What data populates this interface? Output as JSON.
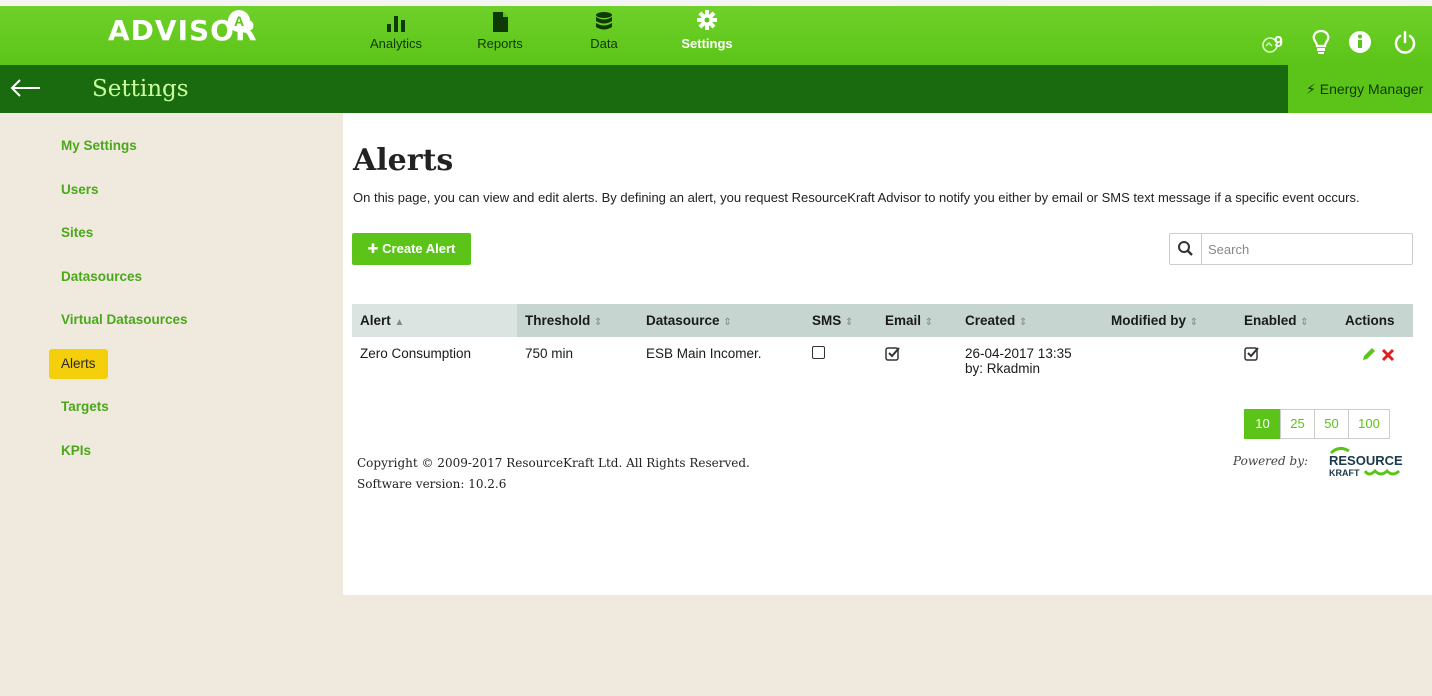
{
  "brand": {
    "logo_text": "ADVISOR",
    "badge": "A"
  },
  "nav": {
    "tabs": [
      {
        "label": "Analytics",
        "icon": "bar-chart-icon"
      },
      {
        "label": "Reports",
        "icon": "document-icon"
      },
      {
        "label": "Data",
        "icon": "database-icon"
      },
      {
        "label": "Settings",
        "icon": "gear-icon",
        "active": true
      }
    ],
    "icons": [
      "notification-icon",
      "lightbulb-icon",
      "info-icon",
      "power-icon"
    ],
    "notification_count": "9"
  },
  "subbar": {
    "title": "Settings",
    "role_button": "Energy Manager"
  },
  "sidebar": {
    "items": [
      {
        "label": "My Settings"
      },
      {
        "label": "Users"
      },
      {
        "label": "Sites"
      },
      {
        "label": "Datasources"
      },
      {
        "label": "Virtual Datasources"
      },
      {
        "label": "Alerts",
        "active": true
      },
      {
        "label": "Targets"
      },
      {
        "label": "KPIs"
      }
    ]
  },
  "main": {
    "title": "Alerts",
    "description": "On this page, you can view and edit alerts. By defining an alert, you request ResourceKraft Advisor to notify you either by email or SMS text message if a specific event occurs.",
    "create_button": "Create Alert",
    "search": {
      "placeholder": "Search"
    },
    "table": {
      "columns": [
        "Alert",
        "Threshold",
        "Datasource",
        "SMS",
        "Email",
        "Created",
        "Modified by",
        "Enabled",
        "Actions"
      ],
      "rows": [
        {
          "alert": "Zero Consumption",
          "threshold": "750 min",
          "datasource": "ESB Main Incomer.",
          "sms": false,
          "email": true,
          "created_date": "26-04-2017 13:35",
          "created_by": "by: Rkadmin",
          "modified_by": "",
          "enabled": true
        }
      ]
    },
    "page_sizes": [
      "10",
      "25",
      "50",
      "100"
    ],
    "active_page_size": "10"
  },
  "footer": {
    "copyright": "Copyright © 2009-2017 ResourceKraft Ltd. All Rights Reserved.",
    "version": "Software version: 10.2.6",
    "powered_by": "Powered by:",
    "logo_text_1": "RESOURCE",
    "logo_text_2": "KRAFT"
  },
  "colors": {
    "accent": "#5cc418",
    "dark_green": "#1a6a10",
    "active_side": "#f5cf0c",
    "delete": "#e02020"
  }
}
